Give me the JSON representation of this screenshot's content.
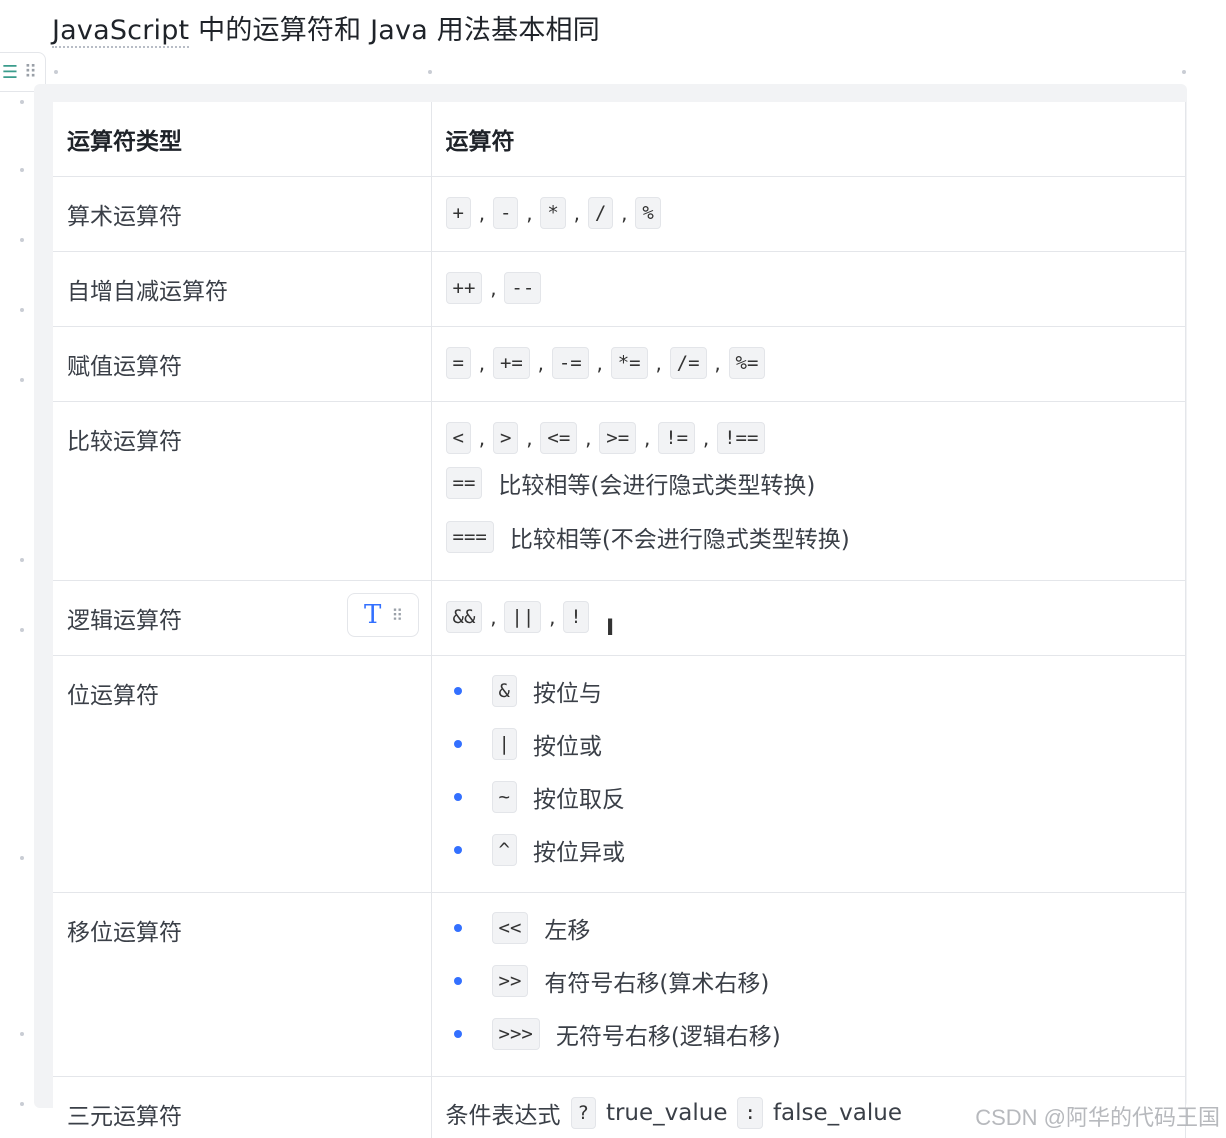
{
  "heading": {
    "part1": "JavaScript",
    "part2": " 中的运算符和 Java 用法基本相同"
  },
  "block_handle": {
    "table_icon": "table-icon",
    "grip_icon": "grip-icon"
  },
  "table": {
    "header": {
      "col1": "运算符类型",
      "col2": "运算符"
    },
    "rows": {
      "arith": {
        "label": "算术运算符",
        "ops": [
          "+",
          "-",
          "*",
          "/",
          "%"
        ]
      },
      "incdec": {
        "label": "自增自减运算符",
        "ops": [
          "++",
          "--"
        ]
      },
      "assign": {
        "label": "赋值运算符",
        "ops": [
          "=",
          "+=",
          "-=",
          "*=",
          "/=",
          "%="
        ]
      },
      "compare": {
        "label": "比较运算符",
        "ops": [
          "<",
          ">",
          "<=",
          ">=",
          "!=",
          "!=="
        ],
        "eq": {
          "op": "==",
          "desc": "比较相等(会进行隐式类型转换)"
        },
        "strict": {
          "op": "===",
          "desc": "比较相等(不会进行隐式类型转换)"
        }
      },
      "logic": {
        "label": "逻辑运算符",
        "ops": [
          "&&",
          "||",
          "!"
        ],
        "tool_icon": "text-type-icon"
      },
      "bit": {
        "label": "位运算符",
        "items": [
          {
            "op": "&",
            "desc": "按位与"
          },
          {
            "op": "|",
            "desc": "按位或"
          },
          {
            "op": "~",
            "desc": "按位取反"
          },
          {
            "op": "^",
            "desc": "按位异或"
          }
        ]
      },
      "shift": {
        "label": "移位运算符",
        "items": [
          {
            "op": "<<",
            "desc": "左移"
          },
          {
            "op": ">>",
            "desc": "有符号右移(算术右移)"
          },
          {
            "op": ">>>",
            "desc": "无符号右移(逻辑右移)"
          }
        ]
      },
      "ternary": {
        "label": "三元运算符",
        "cond": "条件表达式",
        "q": "?",
        "tv": "true_value",
        "colon": ":",
        "fv": "false_value"
      }
    }
  },
  "watermark": "CSDN @阿华的代码王国",
  "colors": {
    "accent": "#3370ff",
    "border": "#e4e6ea",
    "code_bg": "#f2f3f5"
  }
}
